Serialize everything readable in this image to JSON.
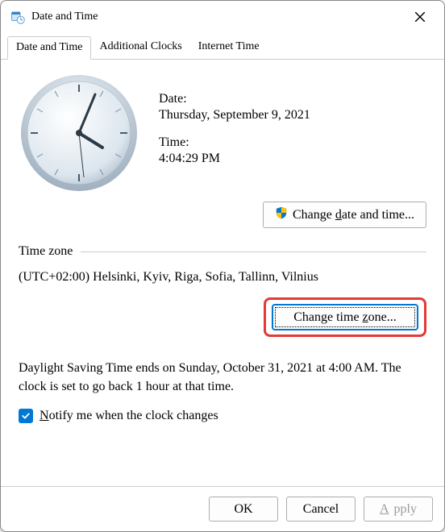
{
  "window": {
    "title": "Date and Time"
  },
  "tabs": [
    {
      "label": "Date and Time",
      "active": true
    },
    {
      "label": "Additional Clocks",
      "active": false
    },
    {
      "label": "Internet Time",
      "active": false
    }
  ],
  "datetime": {
    "date_label": "Date:",
    "date_value": "Thursday, September 9, 2021",
    "time_label": "Time:",
    "time_value": "4:04:29 PM",
    "change_button": "Change date and time...",
    "change_button_underline_char": "d",
    "clock": {
      "hour": 4,
      "minute": 4,
      "second": 29
    }
  },
  "timezone": {
    "group_label": "Time zone",
    "value": "(UTC+02:00) Helsinki, Kyiv, Riga, Sofia, Tallinn, Vilnius",
    "change_button": "Change time zone...",
    "change_button_underline_char": "z"
  },
  "dst": {
    "text": "Daylight Saving Time ends on Sunday, October 31, 2021 at 4:00 AM. The clock is set to go back 1 hour at that time.",
    "notify_checked": true,
    "notify_label": "Notify me when the clock changes",
    "notify_underline_char": "N"
  },
  "footer": {
    "ok": "OK",
    "cancel": "Cancel",
    "apply": "Apply",
    "apply_enabled": false,
    "apply_underline_char": "A"
  },
  "icons": {
    "shield": "shield-icon",
    "close": "close-icon",
    "app": "datetime-app-icon",
    "clock": "analog-clock"
  }
}
